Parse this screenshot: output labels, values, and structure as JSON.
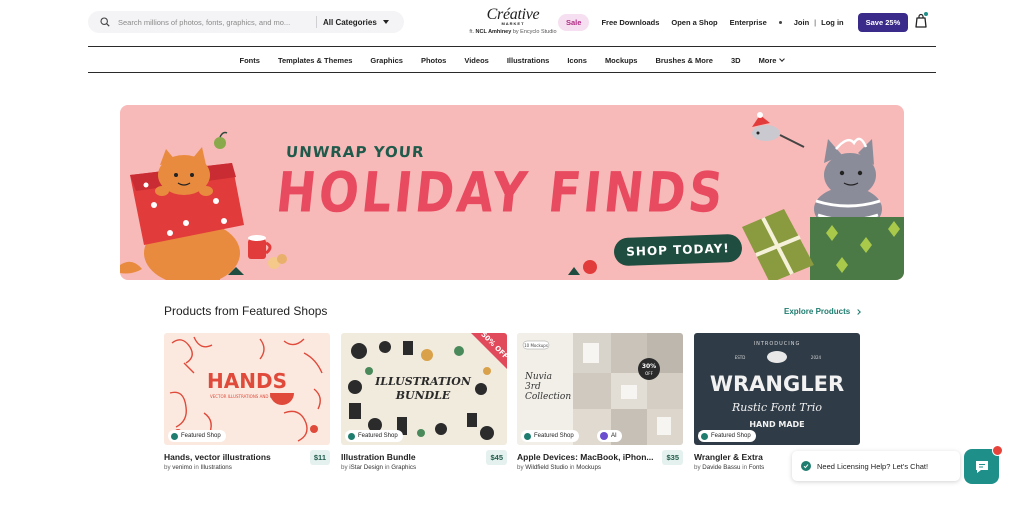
{
  "header": {
    "search_placeholder": "Search millions of photos, fonts, graphics, and mo...",
    "category_label": "All Categories",
    "logo_text": "Créative",
    "logo_sub": "MARKET",
    "byline_prefix": "ft.",
    "byline_name": "NCL Amhiney",
    "byline_suffix": "by Encyclo Studio",
    "sale": "Sale",
    "links": [
      "Free Downloads",
      "Open a Shop",
      "Enterprise"
    ],
    "join": "Join",
    "separator": "|",
    "login": "Log in",
    "save_button": "Save 25%"
  },
  "categories": [
    "Fonts",
    "Templates & Themes",
    "Graphics",
    "Photos",
    "Videos",
    "Illustrations",
    "Icons",
    "Mockups",
    "Brushes & More",
    "3D",
    "More"
  ],
  "banner": {
    "small_text": "UNWRAP YOUR",
    "big_text": "HOLIDAY FINDS",
    "button": "SHOP TODAY!",
    "colors": {
      "background": "#f8b9b9",
      "headline": "#e84a5f",
      "accent": "#1f4d3f"
    }
  },
  "products_section": {
    "title": "Products from Featured Shops",
    "explore": "Explore Products",
    "badge": "Featured Shop",
    "ai_badge": "AI",
    "items": [
      {
        "title": "Hands, vector illustrations",
        "by": "by",
        "author": "venimo",
        "in": "in",
        "category": "Illustrations",
        "price": "$11",
        "thumb_text": "HANDS",
        "thumb_sub": "VECTOR ILLUSTRATIONS AND PRINTS"
      },
      {
        "title": "Illustration Bundle",
        "by": "by",
        "author": "iStar Design",
        "in": "in",
        "category": "Graphics",
        "price": "$45",
        "thumb_text": "ILLUSTRATION",
        "thumb_text2": "BUNDLE",
        "thumb_corner": "50% OFF"
      },
      {
        "title": "Apple Devices: MacBook, iPhon...",
        "by": "by",
        "author": "Wildfield Studio",
        "in": "in",
        "category": "Mockups",
        "price": "$35",
        "thumb_tag": "10 Mockups",
        "thumb_text": "Nuvia",
        "thumb_text2": "3rd",
        "thumb_text3": "Collection",
        "thumb_offer": "30%",
        "thumb_offer2": "OFF"
      },
      {
        "title": "Wrangler & Extra",
        "by": "by",
        "author": "Davide Bassu",
        "in": "in",
        "category": "Fonts",
        "price": "$15",
        "thumb_top": "INTRODUCING",
        "thumb_est": "ESTD",
        "thumb_year": "2024",
        "thumb_text": "WRANGLER",
        "thumb_text2": "Rustic Font Trio",
        "thumb_text3": "HAND MADE"
      }
    ]
  },
  "chat": {
    "text": "Need Licensing Help? Let's Chat!"
  }
}
